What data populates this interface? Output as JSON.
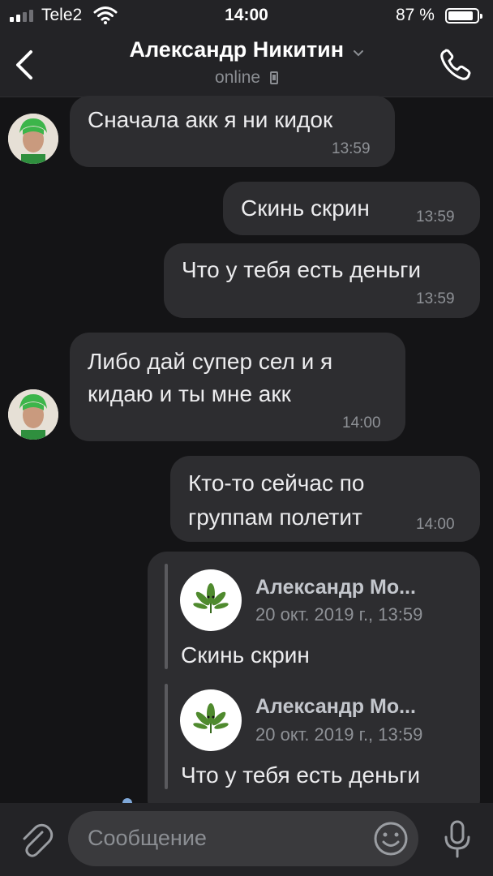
{
  "status_bar": {
    "carrier": "Tele2",
    "time": "14:00",
    "battery_percent": "87 %",
    "battery_level": 0.87
  },
  "header": {
    "title": "Александр Никитин",
    "subtitle": "online"
  },
  "messages": [
    {
      "text_lines": [
        "Сначала акк я ни кидок"
      ],
      "time": "13:59",
      "direction": "incoming"
    },
    {
      "text_lines": [
        "Скинь скрин"
      ],
      "time": "13:59",
      "direction": "outgoing"
    },
    {
      "text_lines": [
        "Что у тебя есть деньги"
      ],
      "time": "13:59",
      "direction": "outgoing"
    },
    {
      "text_lines": [
        "Либо дай супер сел  и я",
        "кидаю и ты мне акк"
      ],
      "time": "14:00",
      "direction": "incoming"
    },
    {
      "text_lines": [
        "Кто-то сейчас по",
        "группам полетит"
      ],
      "time": "14:00",
      "direction": "outgoing"
    }
  ],
  "forwarded": [
    {
      "author": "Александр Мо...",
      "date": "20 окт. 2019 г., 13:59",
      "text": "Скинь скрин"
    },
    {
      "author": "Александр Мо...",
      "date": "20 окт. 2019 г., 13:59",
      "text": "Что у тебя есть деньги"
    }
  ],
  "composer": {
    "placeholder": "Сообщение"
  },
  "icons": {
    "back": "chevron-left-icon",
    "dropdown": "chevron-down-icon",
    "call": "phone-icon",
    "attach": "paperclip-icon",
    "emoji": "smiley-icon",
    "mic": "microphone-icon",
    "forward_avatar": "leaf-icon"
  },
  "colors": {
    "background": "#141416",
    "bar": "#232326",
    "bubble": "#2d2d30",
    "text": "#ececee",
    "muted": "#8e9196"
  }
}
